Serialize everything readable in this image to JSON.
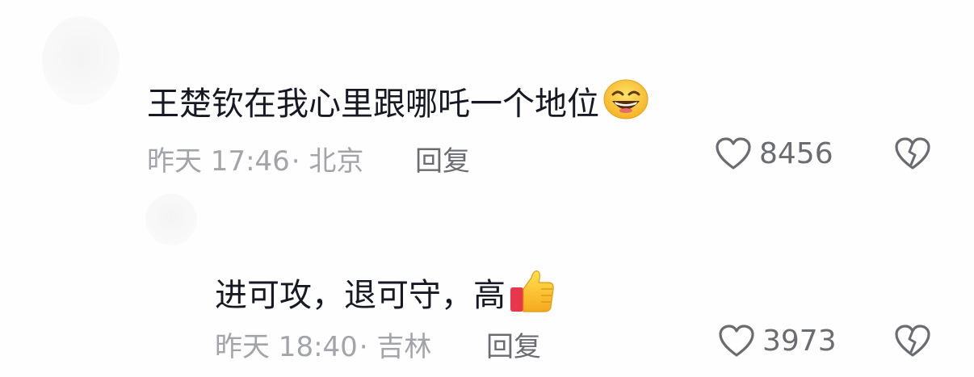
{
  "comments": [
    {
      "text": "王楚钦在我心里跟哪吒一个地位",
      "emoji": "grinning-face-emoji",
      "time": "昨天 17:46",
      "location": "· 北京",
      "reply_label": "回复",
      "likes": "8456",
      "dislike_icon": "broken-heart-icon"
    },
    {
      "text": "进可攻，退可守，高",
      "emoji": "thumbs-up-emoji",
      "time": "昨天 18:40",
      "location": "· 吉林",
      "reply_label": "回复",
      "likes": "3973",
      "dislike_icon": "broken-heart-icon"
    }
  ],
  "colors": {
    "text": "#161823",
    "meta": "#a3a4a9",
    "action": "#6b6c71"
  }
}
